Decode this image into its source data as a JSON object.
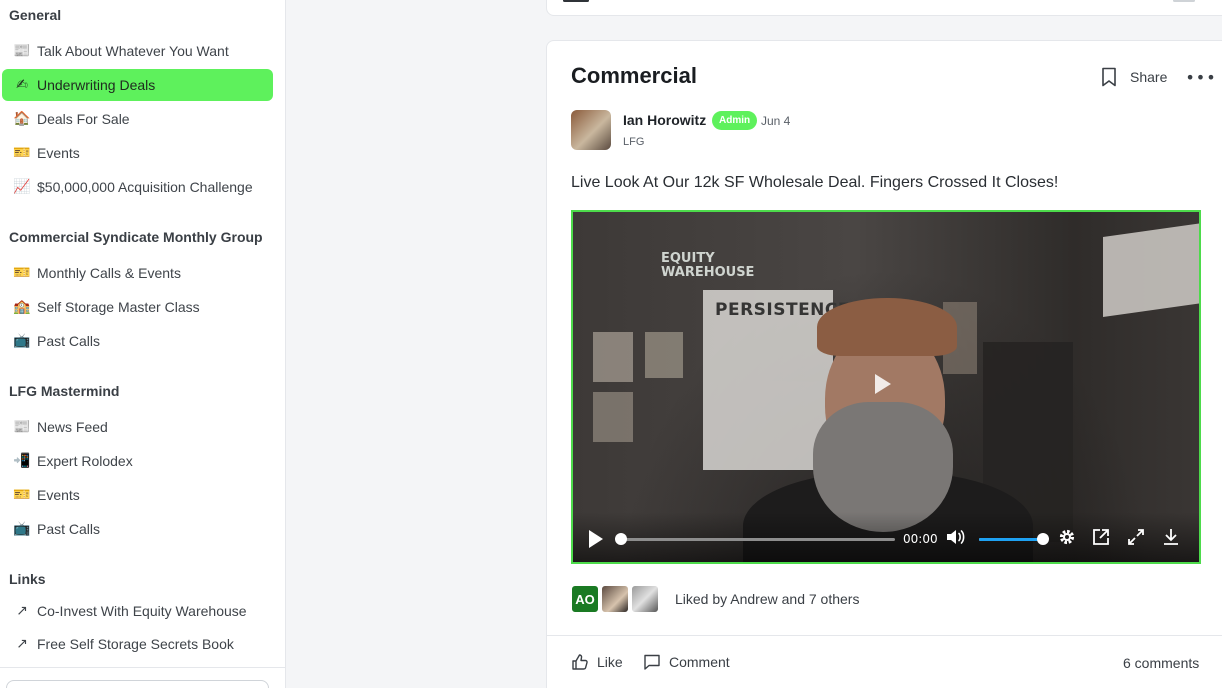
{
  "sidebar": {
    "sections": [
      {
        "title": "General",
        "items": [
          {
            "label": "Talk About Whatever You Want",
            "icon": "newspaper-icon",
            "glyph": "📰"
          },
          {
            "label": "Underwriting Deals",
            "icon": "pencil-icon",
            "glyph": "✍",
            "active": true
          },
          {
            "label": "Deals For Sale",
            "icon": "house-icon",
            "glyph": "🏠"
          },
          {
            "label": "Events",
            "icon": "ticket-icon",
            "glyph": "🎫"
          },
          {
            "label": "$50,000,000 Acquisition Challenge",
            "icon": "chart-icon",
            "glyph": "📈"
          }
        ]
      },
      {
        "title": "Commercial Syndicate Monthly Group",
        "items": [
          {
            "label": "Monthly Calls & Events",
            "icon": "ticket-icon",
            "glyph": "🎫"
          },
          {
            "label": "Self Storage Master Class",
            "icon": "school-icon",
            "glyph": "🏫"
          },
          {
            "label": "Past Calls",
            "icon": "tv-icon",
            "glyph": "📺"
          }
        ]
      },
      {
        "title": "LFG Mastermind",
        "items": [
          {
            "label": "News Feed",
            "icon": "newspaper-icon",
            "glyph": "📰"
          },
          {
            "label": "Expert Rolodex",
            "icon": "phone-icon",
            "glyph": "📲"
          },
          {
            "label": "Events",
            "icon": "ticket-icon",
            "glyph": "🎫"
          },
          {
            "label": "Past Calls",
            "icon": "tv-icon",
            "glyph": "📺"
          }
        ]
      },
      {
        "title": "Links",
        "items": [
          {
            "label": "Co-Invest With Equity Warehouse",
            "icon": "external-link-icon",
            "glyph": "↗"
          },
          {
            "label": "Free Self Storage Secrets Book",
            "icon": "external-link-icon",
            "glyph": "↗"
          }
        ]
      }
    ]
  },
  "post": {
    "title": "Commercial",
    "share_label": "Share",
    "author": "Ian Horowitz",
    "badge": "Admin",
    "date": "Jun 4",
    "author_sub": "LFG",
    "body": "Live Look At Our 12k SF Wholesale Deal. Fingers Crossed It Closes!",
    "video": {
      "poster_text": "PERSISTENCE",
      "sign_text": "EQUITY WAREHOUSE",
      "time": "00:00",
      "progress": 0.0,
      "volume": 1.0
    },
    "likes": {
      "initials": "AO",
      "text": "Liked by Andrew and 7 others"
    },
    "like_label": "Like",
    "comment_label": "Comment",
    "comments_count": "6 comments"
  },
  "colors": {
    "accent": "#5ef15c",
    "video_border": "#4ddb4b",
    "volume": "#1ea1f2",
    "initials_avatar": "#1a7a23"
  }
}
